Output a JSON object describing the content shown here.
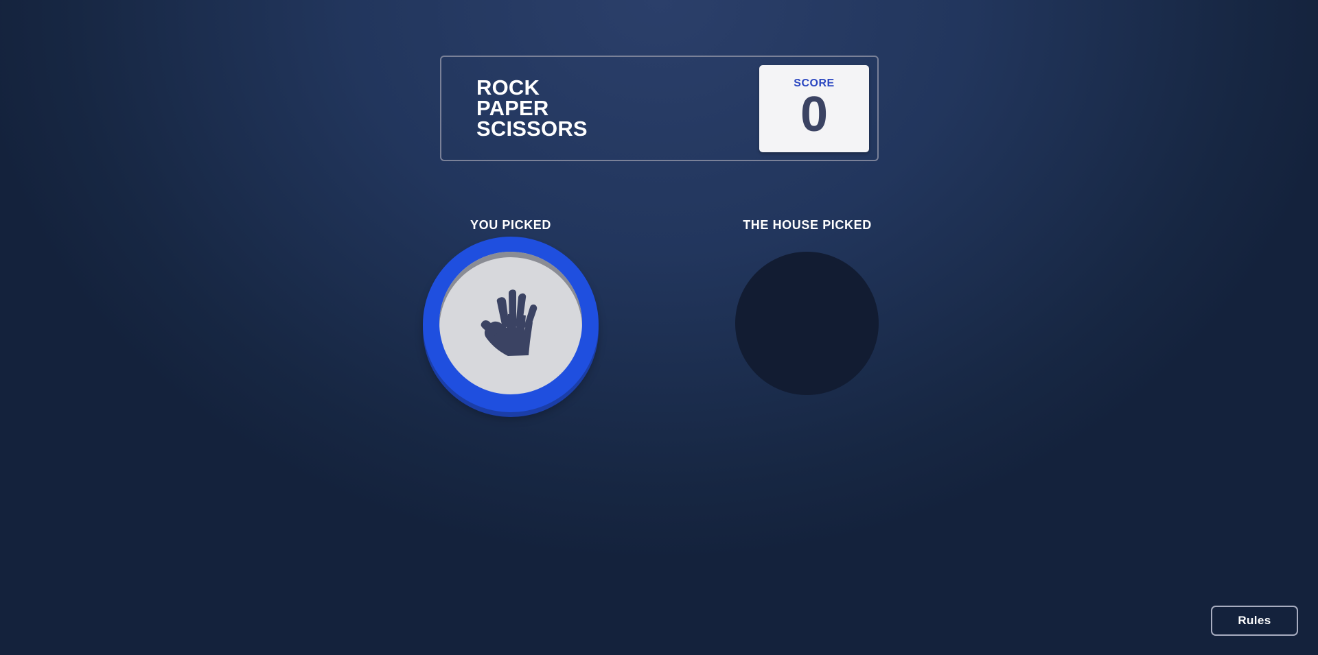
{
  "header": {
    "title_lines": [
      "ROCK",
      "PAPER",
      "SCISSORS"
    ],
    "score_label": "SCORE",
    "score_value": "0"
  },
  "picks": {
    "you_label": "YOU PICKED",
    "you_choice": "paper",
    "you_icon": "paper-hand-icon",
    "house_label": "THE HOUSE PICKED",
    "house_choice": ""
  },
  "rules_button": {
    "label": "Rules"
  },
  "colors": {
    "background_top": "#2b3f6a",
    "background_bottom": "#14223c",
    "paper_ring": "#1f4fdf",
    "score_label": "#2a46c0",
    "score_value": "#3b4363",
    "house_slot": "#121c32",
    "hand_icon": "#3b4363"
  }
}
